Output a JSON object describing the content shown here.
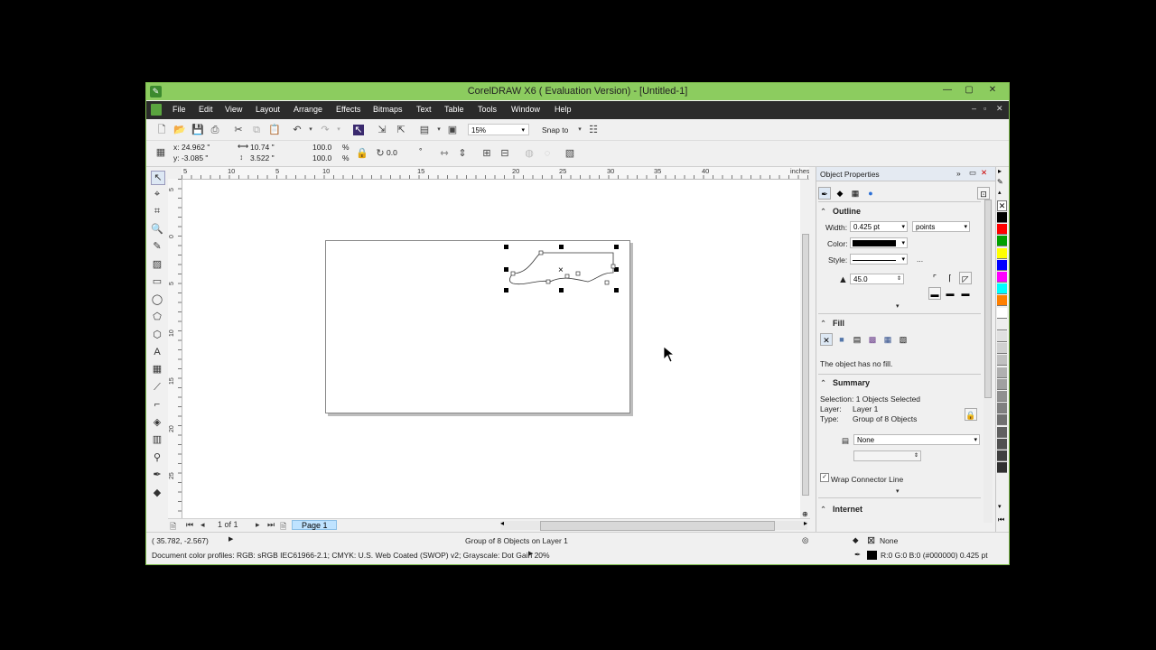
{
  "window": {
    "title": "CorelDRAW X6 ( Evaluation Version) - [Untitled-1]",
    "buttons": {
      "minimize": "—",
      "maximize": "▢",
      "close": "✕"
    }
  },
  "menu": [
    "File",
    "Edit",
    "View",
    "Layout",
    "Arrange",
    "Effects",
    "Bitmaps",
    "Text",
    "Table",
    "Tools",
    "Window",
    "Help"
  ],
  "mdi_buttons": {
    "minimize": "–",
    "restore": "▫",
    "close": "✕"
  },
  "toolbar": {
    "zoom": "15%",
    "snap_to": "Snap to"
  },
  "property_bar": {
    "x": "x: 24.962 \"",
    "y": "y: -3.085 \"",
    "width": "10.74 \"",
    "height": "3.522 \"",
    "scale_x": "100.0",
    "scale_y": "100.0",
    "pct": "%",
    "angle": "0.0",
    "degree": "°"
  },
  "ruler": {
    "h_ticks": [
      "5",
      "10",
      "5",
      "10",
      "15",
      "20",
      "25",
      "30",
      "35",
      "40"
    ],
    "units": "inches",
    "v_ticks": [
      "5",
      "0",
      "5",
      "10",
      "15",
      "20",
      "25"
    ]
  },
  "navigator": {
    "page_count": "1 of 1",
    "page_tab": "Page 1"
  },
  "status": {
    "cursor": "( 35.782, -2.567)",
    "selection": "Group of 8 Objects on Layer 1",
    "color_profiles": "Document color profiles: RGB: sRGB IEC61966-2.1; CMYK: U.S. Web Coated (SWOP) v2; Grayscale: Dot Gain 20%",
    "fill": "None",
    "outline": "R:0 G:0 B:0 (#000000)  0.425 pt"
  },
  "docker": {
    "title": "Object Properties",
    "outline": {
      "heading": "Outline",
      "width_label": "Width:",
      "width_value": "0.425 pt",
      "width_units": "points",
      "color_label": "Color:",
      "style_label": "Style:",
      "style_more": "...",
      "miter": "45.0"
    },
    "fill": {
      "heading": "Fill",
      "message": "The object has no fill."
    },
    "summary": {
      "heading": "Summary",
      "selection": "Selection: 1 Objects Selected",
      "layer_label": "Layer:",
      "layer_value": "Layer 1",
      "type_label": "Type:",
      "type_value": "Group of 8 Objects",
      "wrap_value": "None",
      "wrap_connector": "Wrap Connector Line"
    },
    "internet": {
      "heading": "Internet"
    }
  },
  "palette_colors": [
    "#000000",
    "#ff0000",
    "#00a000",
    "#ffff00",
    "#0000ff",
    "#ff00ff",
    "#00ffff",
    "#ff8000",
    "#ffffff",
    "#eeeeee",
    "#e0e0e0",
    "#d0d0d0",
    "#c0c0c0",
    "#b0b0b0",
    "#a0a0a0",
    "#909090",
    "#808080",
    "#707070",
    "#606060",
    "#505050",
    "#404040",
    "#303030"
  ],
  "colors": {
    "title_bar": "#8ccc5f",
    "menu_bar": "#2b2b2b",
    "page_tab": "#bfe3ff",
    "outline_color": "#000000"
  }
}
